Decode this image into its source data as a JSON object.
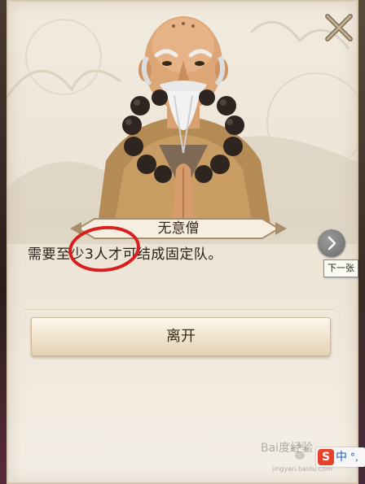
{
  "npc": {
    "name": "无意僧",
    "dialog": "需要至少3人才可结成固定队。"
  },
  "actions": {
    "leave_label": "离开",
    "next_tooltip": "下一张"
  },
  "icons": {
    "close": "close-x-icon",
    "next": "chevron-right-icon",
    "ime": "sogou-input-icon"
  },
  "ime": {
    "logo": "S",
    "mode": "中",
    "punct": "°,"
  },
  "watermark": {
    "text": "Bai度经验",
    "url": "jingyan.baidu.com"
  },
  "colors": {
    "panel": "#efe7d9",
    "annotation_circle": "#d81e1e",
    "button_text": "#3a2a1a"
  }
}
